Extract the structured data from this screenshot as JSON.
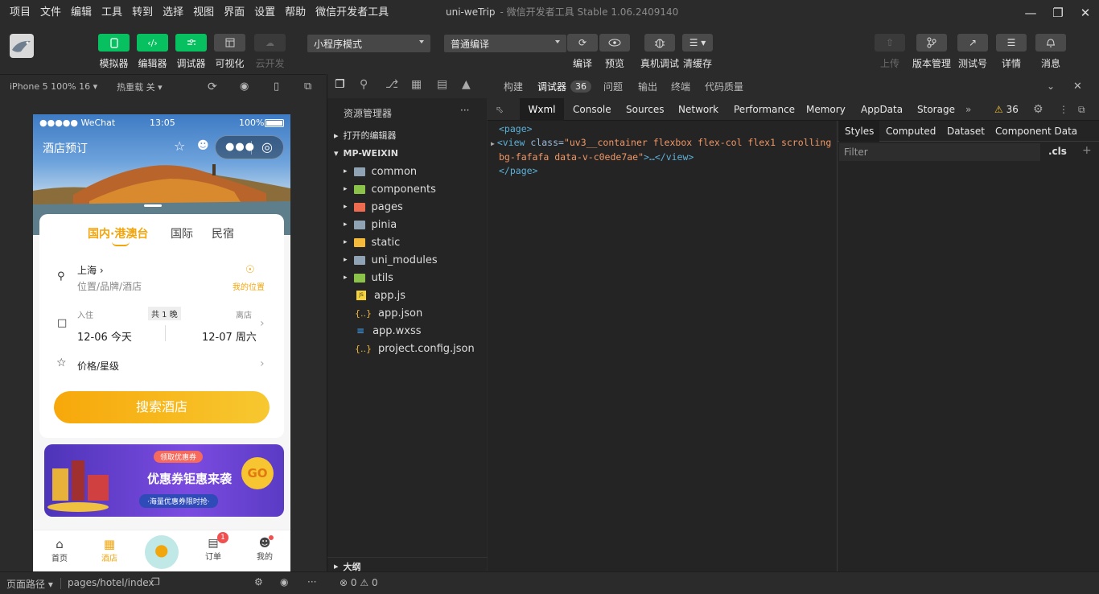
{
  "menu": [
    "项目",
    "文件",
    "编辑",
    "工具",
    "转到",
    "选择",
    "视图",
    "界面",
    "设置",
    "帮助",
    "微信开发者工具"
  ],
  "window": {
    "title": "uni-weTrip",
    "subtitle": "- 微信开发者工具 Stable 1.06.2409140"
  },
  "toolbar": {
    "left": [
      {
        "label": "模拟器",
        "icon": "phone-icon"
      },
      {
        "label": "编辑器",
        "icon": "code-icon"
      },
      {
        "label": "调试器",
        "icon": "debug-icon"
      },
      {
        "label": "可视化",
        "icon": "layout-icon"
      },
      {
        "label": "云开发",
        "icon": "cloud-icon"
      }
    ],
    "mode_select": "小程序模式",
    "compile_select": "普通编译",
    "mid": [
      {
        "label": "编译",
        "icon": "refresh-icon"
      },
      {
        "label": "预览",
        "icon": "eye-icon"
      },
      {
        "label": "真机调试",
        "icon": "bug-icon"
      },
      {
        "label": "清缓存",
        "icon": "layers-icon"
      }
    ],
    "right": [
      {
        "label": "上传",
        "icon": "upload-icon"
      },
      {
        "label": "版本管理",
        "icon": "branch-icon"
      },
      {
        "label": "测试号",
        "icon": "external-icon"
      },
      {
        "label": "详情",
        "icon": "menu-icon"
      },
      {
        "label": "消息",
        "icon": "bell-icon"
      }
    ]
  },
  "simbar": {
    "device": "iPhone 5 100% 16",
    "hotreload": "热重载 关"
  },
  "phone": {
    "status": {
      "signal": "●●●●● WeChat",
      "time": "13:05",
      "battery": "100%"
    },
    "nav_title": "酒店预订",
    "tabs": [
      "国内·港澳台",
      "国际",
      "民宿"
    ],
    "city": "上海",
    "search_placeholder": "位置/品牌/酒店",
    "my_location": "我的位置",
    "checkin_label": "入住",
    "nights": "共 1 晚",
    "checkout_label": "离店",
    "checkin_date": "12-06 今天",
    "checkout_date": "12-07 周六",
    "price_star": "价格/星级",
    "search_btn": "搜索酒店",
    "banner": {
      "tag": "领取优惠券",
      "title": "优惠券钜惠来袭",
      "sub": "·海量优惠券限时抢·",
      "go": "GO"
    },
    "tabbar": [
      {
        "label": "首页",
        "icon": "home-icon"
      },
      {
        "label": "酒店",
        "icon": "hotel-icon"
      },
      {
        "label": "",
        "icon": "balloon-icon"
      },
      {
        "label": "订单",
        "icon": "order-icon",
        "badge": "1"
      },
      {
        "label": "我的",
        "icon": "user-icon"
      }
    ]
  },
  "explorer": {
    "title": "资源管理器",
    "open_editors": "打开的编辑器",
    "project": "MP-WEIXIN",
    "folders": [
      "common",
      "components",
      "pages",
      "pinia",
      "static",
      "uni_modules",
      "utils"
    ],
    "files": [
      "app.js",
      "app.json",
      "app.wxss",
      "project.config.json"
    ],
    "outline": "大纲"
  },
  "devtop": {
    "tabs": [
      "构建",
      "调试器",
      "问题",
      "输出",
      "终端",
      "代码质量"
    ],
    "badge": "36"
  },
  "devtabs": {
    "tabs": [
      "Wxml",
      "Console",
      "Sources",
      "Network",
      "Performance",
      "Memory",
      "AppData",
      "Storage"
    ],
    "warn": "36"
  },
  "wxml": {
    "line1": "<page>",
    "tag2": "<view",
    "attr2": "class=",
    "val2": "\"uv3__container flexbox flex-col flex1 scrolling",
    "val2b": "bg-fafafa data-v-c0ede7ae\"",
    "end2": ">…</view>",
    "line3": "</page>"
  },
  "styles": {
    "tabs": [
      "Styles",
      "Computed",
      "Dataset",
      "Component Data"
    ],
    "filter": "Filter",
    "cls": ".cls"
  },
  "statusbar": {
    "path_label": "页面路径",
    "path": "pages/hotel/index",
    "errors": "0",
    "warnings": "0"
  }
}
